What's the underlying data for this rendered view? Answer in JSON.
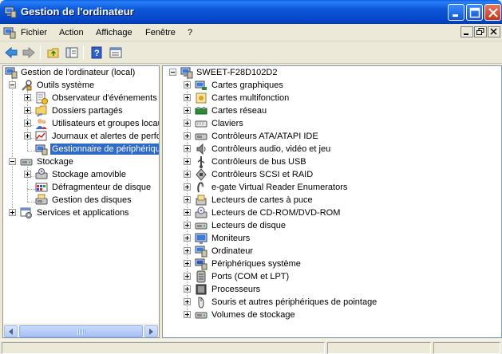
{
  "window": {
    "title": "Gestion de l'ordinateur",
    "controls": [
      "minimize-icon",
      "maximize-icon",
      "close-icon"
    ]
  },
  "menu": {
    "items": [
      "Fichier",
      "Action",
      "Affichage",
      "Fenêtre",
      "?"
    ]
  },
  "toolbar": {
    "buttons": [
      "back-arrow-icon",
      "forward-arrow-icon",
      "up-folder-icon",
      "show-hide-tree-icon",
      "help-icon",
      "properties-icon"
    ]
  },
  "tree": {
    "root": "Gestion de l'ordinateur (local)",
    "system_tools": "Outils système",
    "event_viewer": "Observateur d'événements",
    "shared_folders": "Dossiers partagés",
    "users_groups": "Utilisateurs et groupes locaux",
    "perf_logs": "Journaux et alertes de performance",
    "device_manager": "Gestionnaire de périphériques",
    "storage": "Stockage",
    "removable": "Stockage amovible",
    "defrag": "Défragmenteur de disque",
    "disk_mgmt": "Gestion des disques",
    "services": "Services et applications"
  },
  "devices": {
    "computer_name": "SWEET-F28D102D2",
    "categories": [
      "Cartes graphiques",
      "Cartes multifonction",
      "Cartes réseau",
      "Claviers",
      "Contrôleurs ATA/ATAPI IDE",
      "Contrôleurs audio, vidéo et jeu",
      "Contrôleurs de bus USB",
      "Contrôleurs SCSI et RAID",
      "e-gate Virtual Reader Enumerators",
      "Lecteurs de cartes à puce",
      "Lecteurs de CD-ROM/DVD-ROM",
      "Lecteurs de disque",
      "Moniteurs",
      "Ordinateur",
      "Périphériques système",
      "Ports (COM et LPT)",
      "Processeurs",
      "Souris et autres périphériques de pointage",
      "Volumes de stockage"
    ]
  },
  "colors": {
    "titlebar": "#0a57d8",
    "selection": "#316ac5",
    "chrome": "#ece9d8"
  }
}
